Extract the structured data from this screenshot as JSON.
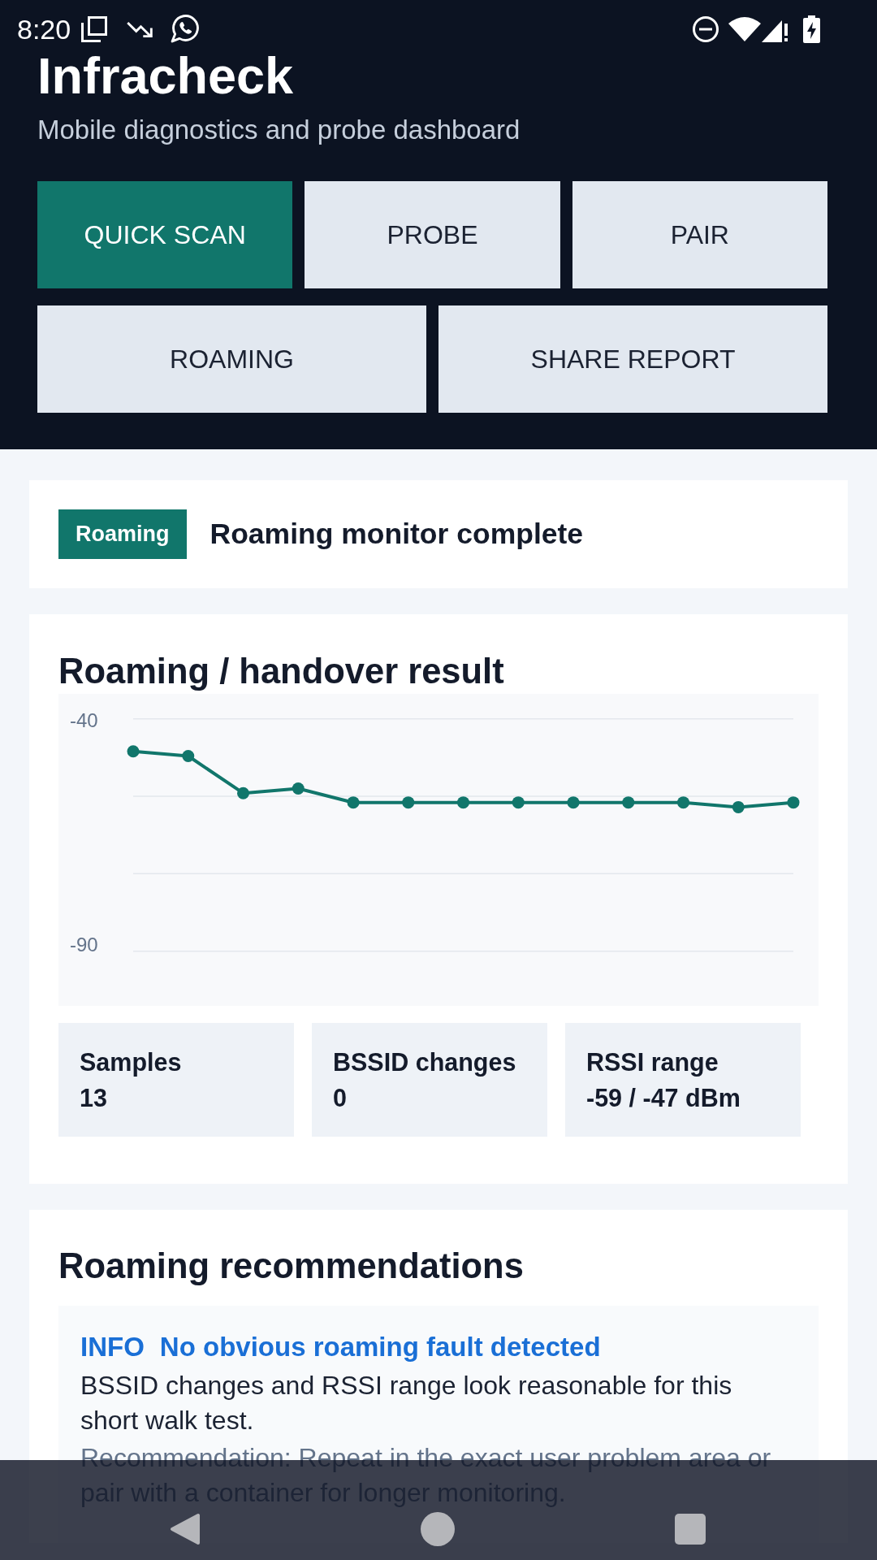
{
  "status_bar": {
    "time": "8:20"
  },
  "header": {
    "title": "Infracheck",
    "subtitle": "Mobile diagnostics and probe dashboard"
  },
  "action_rows": [
    {
      "buttons": [
        {
          "label": "QUICK SCAN",
          "kind": "primary"
        },
        {
          "label": "PROBE",
          "kind": "secondary"
        },
        {
          "label": "PAIR",
          "kind": "secondary"
        }
      ]
    },
    {
      "buttons": [
        {
          "label": "ROAMING",
          "kind": "secondary"
        },
        {
          "label": "SHARE REPORT",
          "kind": "secondary"
        }
      ]
    }
  ],
  "status_card": {
    "badge": "Roaming",
    "message": "Roaming monitor complete"
  },
  "result_card": {
    "title": "Roaming / handover result",
    "chart_data": {
      "type": "line",
      "series": [
        {
          "color": "#11766b",
          "marker": "circle",
          "values": [
            -47,
            -48,
            -56,
            -55,
            -58,
            -58,
            -58,
            -58,
            -58,
            -58,
            -58,
            -59,
            -58
          ]
        }
      ],
      "ylim": [
        -90,
        -40
      ],
      "yticks": [
        -40,
        -90
      ],
      "ref_lines": [
        {
          "axis": "y",
          "value": -56.67
        },
        {
          "axis": "y",
          "value": -73.33
        }
      ]
    },
    "stats": [
      {
        "label": "Samples",
        "value": "13"
      },
      {
        "label": "BSSID changes",
        "value": "0"
      },
      {
        "label": "RSSI range",
        "value": "-59 / -47 dBm"
      }
    ]
  },
  "recommendations_card": {
    "title": "Roaming recommendations",
    "findings": [
      {
        "kind": "info",
        "severity": "INFO",
        "title": "No obvious roaming fault detected",
        "detail": "BSSID changes and RSSI range look reasonable for this short walk test.",
        "recommendation": "Recommendation: Repeat in the exact user problem area or pair with a container for longer monitoring."
      }
    ]
  }
}
